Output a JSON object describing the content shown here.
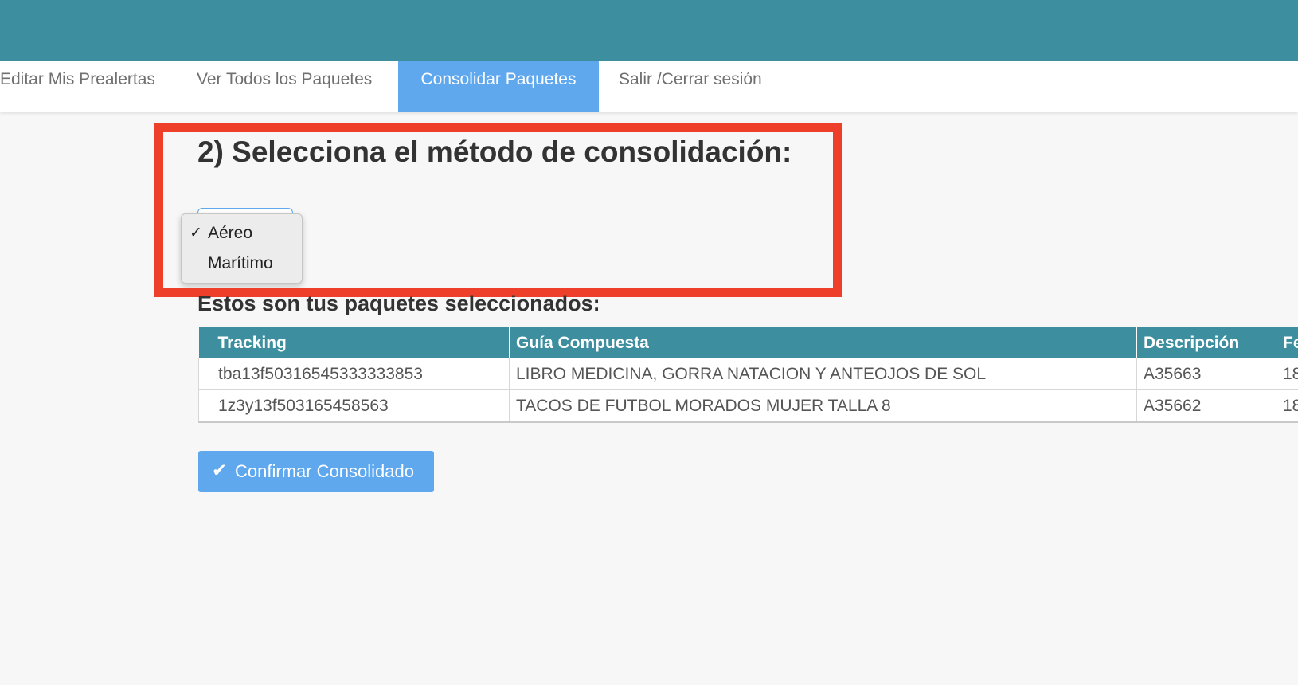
{
  "nav": {
    "tabs": [
      {
        "label": "Editar Mis Prealertas",
        "active": false
      },
      {
        "label": "Ver Todos los Paquetes",
        "active": false
      },
      {
        "label": "Consolidar Paquetes",
        "active": true
      },
      {
        "label": "Salir /Cerrar sesión",
        "active": false
      }
    ]
  },
  "step": {
    "title": "2) Selecciona el método de consolidación:"
  },
  "method_select": {
    "selected": "Aéreo",
    "options": [
      {
        "label": "Aéreo",
        "checked": true,
        "check_glyph": "✓"
      },
      {
        "label": "Marítimo",
        "checked": false,
        "check_glyph": ""
      }
    ]
  },
  "packages": {
    "heading": "Estos son tus paquetes seleccionados:",
    "columns": [
      "Tracking",
      "Guía Compuesta",
      "Descripción",
      "Fe"
    ],
    "rows": [
      [
        "tba13f50316545333333853",
        "LIBRO MEDICINA, GORRA NATACION Y ANTEOJOS DE SOL",
        "A35663",
        "18"
      ],
      [
        "1z3y13f503165458563",
        "TACOS DE FUTBOL MORADOS MUJER TALLA 8",
        "A35662",
        "18"
      ]
    ]
  },
  "confirm": {
    "icon": "check-icon",
    "icon_glyph": "✔",
    "label": "Confirmar Consolidado"
  },
  "colors": {
    "header_teal": "#3d8f9f",
    "accent_blue": "#5fa8ee",
    "highlight_red": "#ee3f2a",
    "page_bg": "#f7f7f7"
  }
}
